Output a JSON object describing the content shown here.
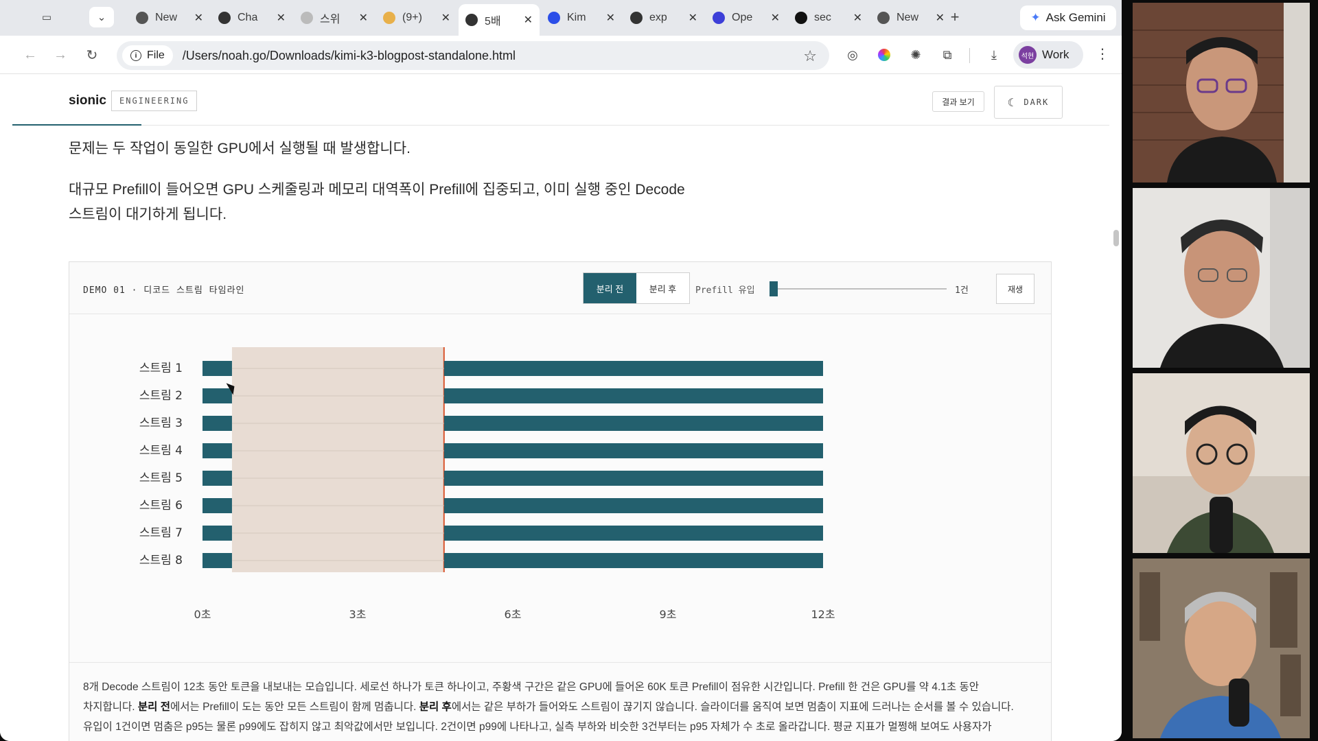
{
  "tabs": [
    {
      "title": "New",
      "icon": "chrome-icon",
      "active": false
    },
    {
      "title": "Cha",
      "icon": "openai-icon",
      "active": false
    },
    {
      "title": "스위",
      "icon": "loading-icon",
      "active": false
    },
    {
      "title": "(9+)",
      "icon": "avatar-icon",
      "active": false
    },
    {
      "title": "5배",
      "icon": "globe-icon",
      "active": true
    },
    {
      "title": "Kim",
      "icon": "kimi-icon",
      "active": false
    },
    {
      "title": "exp",
      "icon": "globe-icon",
      "active": false
    },
    {
      "title": "Ope",
      "icon": "og-icon",
      "active": false
    },
    {
      "title": "sec",
      "icon": "github-icon",
      "active": false
    },
    {
      "title": "New",
      "icon": "chrome-icon",
      "active": false
    }
  ],
  "gemini_label": "Ask Gemini",
  "address": {
    "chip": "File",
    "url": "/Users/noah.go/Downloads/kimi-k3-blogpost-standalone.html"
  },
  "profile": {
    "name": "Work",
    "avatar": "석현"
  },
  "site": {
    "logo": "sionic",
    "badge": "ENGINEERING",
    "results_button": "결과 보기",
    "dark_button": "DARK"
  },
  "article": {
    "para1": "문제는 두 작업이 동일한 GPU에서 실행될 때 발생합니다.",
    "para2_line1": "대규모 Prefill이 들어오면 GPU 스케줄링과 메모리 대역폭이 Prefill에 집중되고, 이미 실행 중인 Decode",
    "para2_line2": "스트림이 대기하게 됩니다."
  },
  "demo": {
    "label": "DEMO 01 · 디코드 스트림 타임라인",
    "seg_before": "분리 전",
    "seg_after": "분리 후",
    "slider_label": "Prefill 유입",
    "slider_value": "1건",
    "slider_fraction": 0.0,
    "play_label": "재생",
    "desc_1": "8개 Decode 스트림이 12초 동안 토큰을 내보내는 모습입니다. 세로선 하나가 토큰 하나이고, 주황색 구간은 같은 GPU에 들어온 60K 토큰 Prefill이 점유한 시간입니다. Prefill 한 건은 GPU를 약 4.1초 동안",
    "desc_2a": "차지합니다. ",
    "desc_2b": "분리 전",
    "desc_2c": "에서는 Prefill이 도는 동안 모든 스트림이 함께 멈춥니다. ",
    "desc_2d": "분리 후",
    "desc_2e": "에서는 같은 부하가 들어와도 스트림이 끊기지 않습니다. 슬라이더를 움직여 보면 멈춤이 지표에 드러나는 순서를 볼 수 있습니다.",
    "desc_3": "유입이 1건이면 멈춤은 p95는 물론 p99에도 잡히지 않고 최악값에서만 보입니다. 2건이면 p99에 나타나고, 실측 부하와 비슷한 3건부터는 p95 자체가 수 초로 올라갑니다. 평균 지표가 멀쩡해 보여도 사용자가"
  },
  "chart_data": {
    "type": "timeline",
    "streams": [
      "스트림 1",
      "스트림 2",
      "스트림 3",
      "스트림 4",
      "스트림 5",
      "스트림 6",
      "스트림 7",
      "스트림 8"
    ],
    "x_ticks": [
      "0초",
      "3초",
      "6초",
      "9초",
      "12초"
    ],
    "xlim": [
      0,
      12
    ],
    "prefill_block": {
      "start": 0.57,
      "end": 4.67
    },
    "segments": [
      [
        [
          0,
          0.57
        ],
        [
          4.67,
          12
        ]
      ],
      [
        [
          0,
          0.57
        ],
        [
          4.67,
          12
        ]
      ],
      [
        [
          0,
          0.57
        ],
        [
          4.67,
          12
        ]
      ],
      [
        [
          0,
          0.57
        ],
        [
          4.67,
          12
        ]
      ],
      [
        [
          0,
          0.57
        ],
        [
          4.67,
          12
        ]
      ],
      [
        [
          0,
          0.57
        ],
        [
          4.67,
          12
        ]
      ],
      [
        [
          0,
          0.57
        ],
        [
          4.67,
          12
        ]
      ],
      [
        [
          0,
          0.57
        ],
        [
          4.67,
          12
        ]
      ]
    ],
    "colors": {
      "token": "#23606e",
      "prefill": "#e8dcd3",
      "prefill_edge": "#d9532c"
    }
  }
}
